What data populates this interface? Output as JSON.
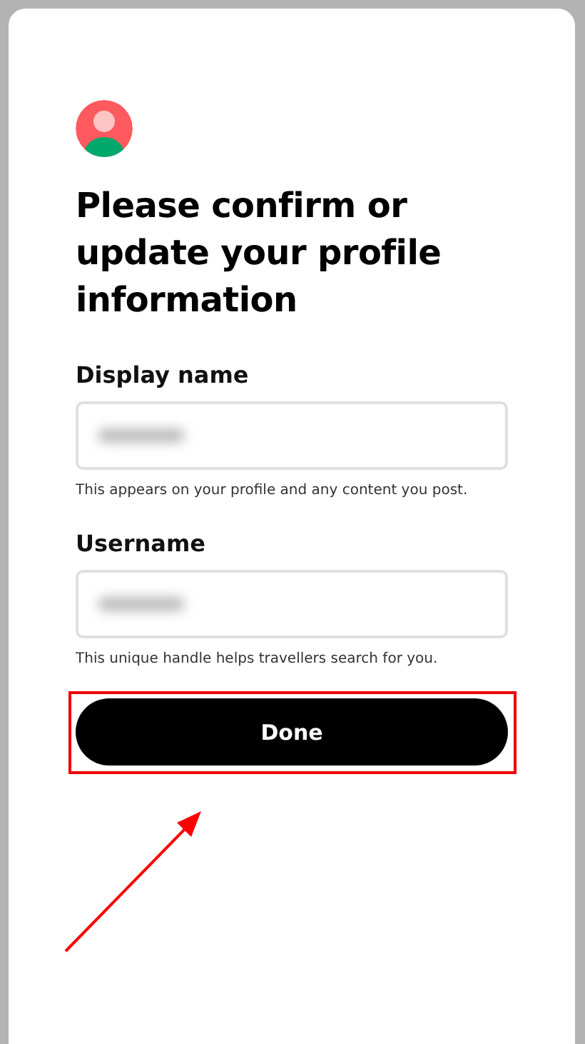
{
  "dialog": {
    "title": "Please confirm or update your profile information",
    "fields": [
      {
        "label": "Display name",
        "help": "This appears on your profile and any content you post."
      },
      {
        "label": "Username",
        "help": "This unique handle helps travellers search for you."
      }
    ],
    "button": "Done"
  }
}
